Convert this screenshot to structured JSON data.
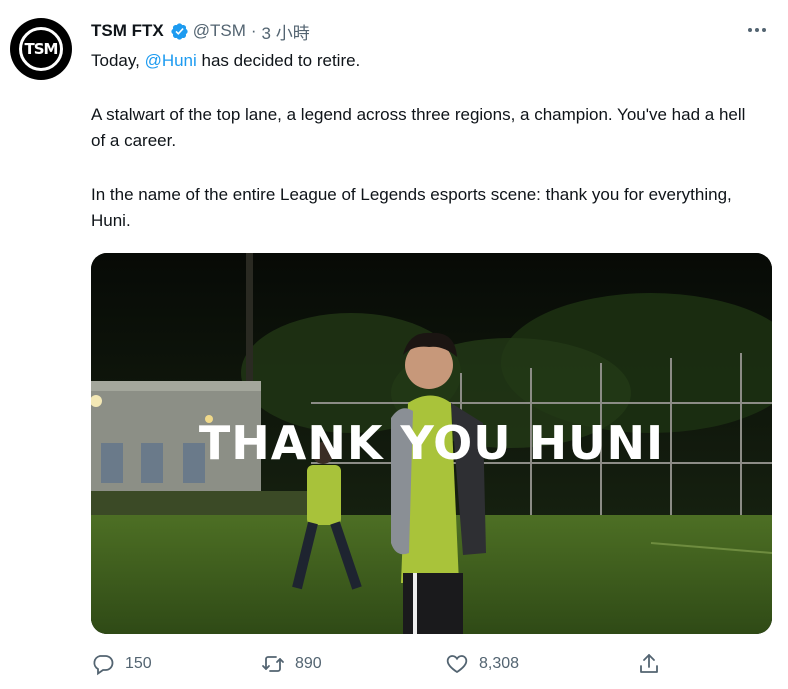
{
  "tweet": {
    "display_name": "TSM FTX",
    "handle": "@TSM",
    "separator": "·",
    "timestamp": "3 小時",
    "avatar_text": "TSM",
    "text": {
      "line1_prefix": "Today, ",
      "mention": "@Huni",
      "line1_suffix": " has decided to retire.",
      "para2": "A stalwart of the top lane, a legend across three regions, a champion. You've had a hell of a career.",
      "para3": "In the name of the entire League of Legends esports scene: thank you for everything, Huni."
    },
    "media": {
      "caption": "THANK YOU HUNI"
    },
    "actions": {
      "reply_count": "150",
      "retweet_count": "890",
      "like_count": "8,308"
    }
  },
  "colors": {
    "accent": "#1d9bf0",
    "secondary_text": "#536471",
    "primary_text": "#0f1419"
  },
  "icons": [
    "tsm-logo-icon",
    "verified-badge-icon",
    "more-options-icon",
    "reply-icon",
    "retweet-icon",
    "like-icon",
    "share-icon"
  ]
}
